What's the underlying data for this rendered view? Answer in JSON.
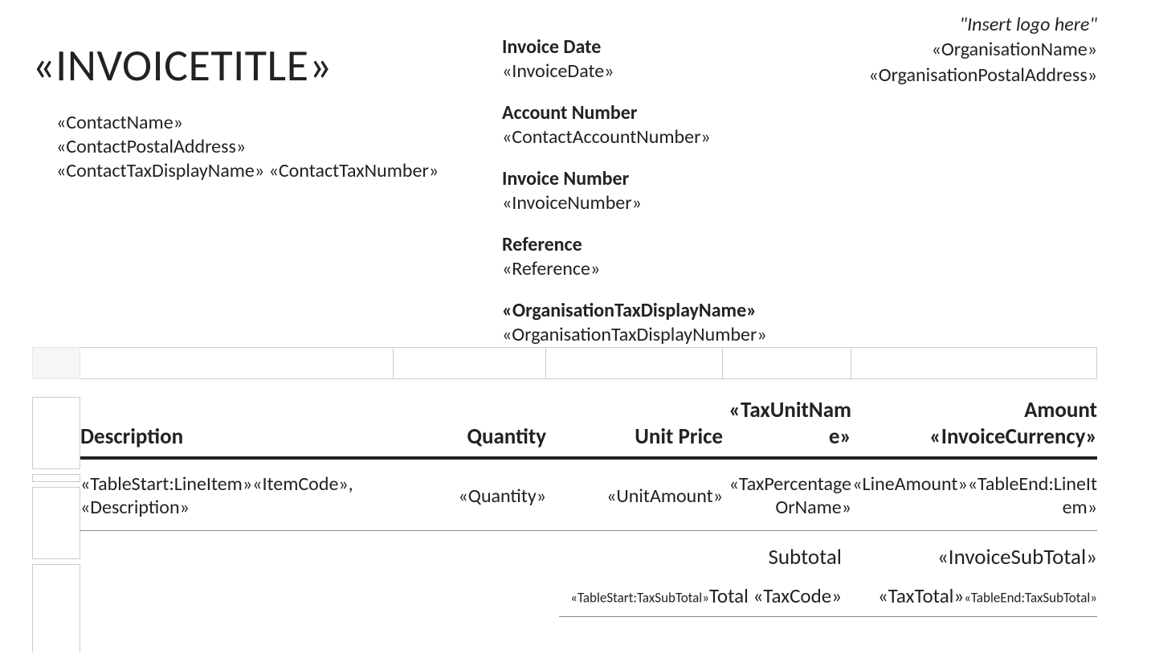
{
  "title": "«INVOICETITLE»",
  "contact": {
    "name": "«ContactName»",
    "postal": "«ContactPostalAddress»",
    "tax_display": "«ContactTaxDisplayName»",
    "tax_number": "«ContactTaxNumber»"
  },
  "meta": {
    "invoice_date_label": "Invoice Date",
    "invoice_date": "«InvoiceDate»",
    "account_number_label": "Account Number",
    "account_number": "«ContactAccountNumber»",
    "invoice_number_label": "Invoice Number",
    "invoice_number": "«InvoiceNumber»",
    "reference_label": "Reference",
    "reference": "«Reference»",
    "org_tax_display_label": "«OrganisationTaxDisplayName»",
    "org_tax_display_number": "«OrganisationTaxDisplayNumber»"
  },
  "org": {
    "logo_hint": "\"Insert logo here\"",
    "name": "«OrganisationName»",
    "postal": "«OrganisationPostalAddress»"
  },
  "table": {
    "headers": {
      "description": "Description",
      "quantity": "Quantity",
      "unit_price": "Unit Price",
      "tax": "«TaxUnitName»",
      "amount_line1": "Amount",
      "amount_line2": "«InvoiceCurrency»"
    },
    "row": {
      "description": "«TableStart:LineItem»«ItemCode», «Description»",
      "quantity": "«Quantity»",
      "unit_amount": "«UnitAmount»",
      "tax_pct": "«TaxPercentageOrName»",
      "line_amount": "«LineAmount»«TableEnd:LineItem»"
    }
  },
  "totals": {
    "subtotal_label": "Subtotal",
    "subtotal_value": "«InvoiceSubTotal»",
    "tax_prefix_small": "«TableStart:TaxSubTotal»",
    "tax_label": "Total «TaxCode»",
    "tax_value": "«TaxTotal»",
    "tax_suffix_small": "«TableEnd:TaxSubTotal»"
  }
}
